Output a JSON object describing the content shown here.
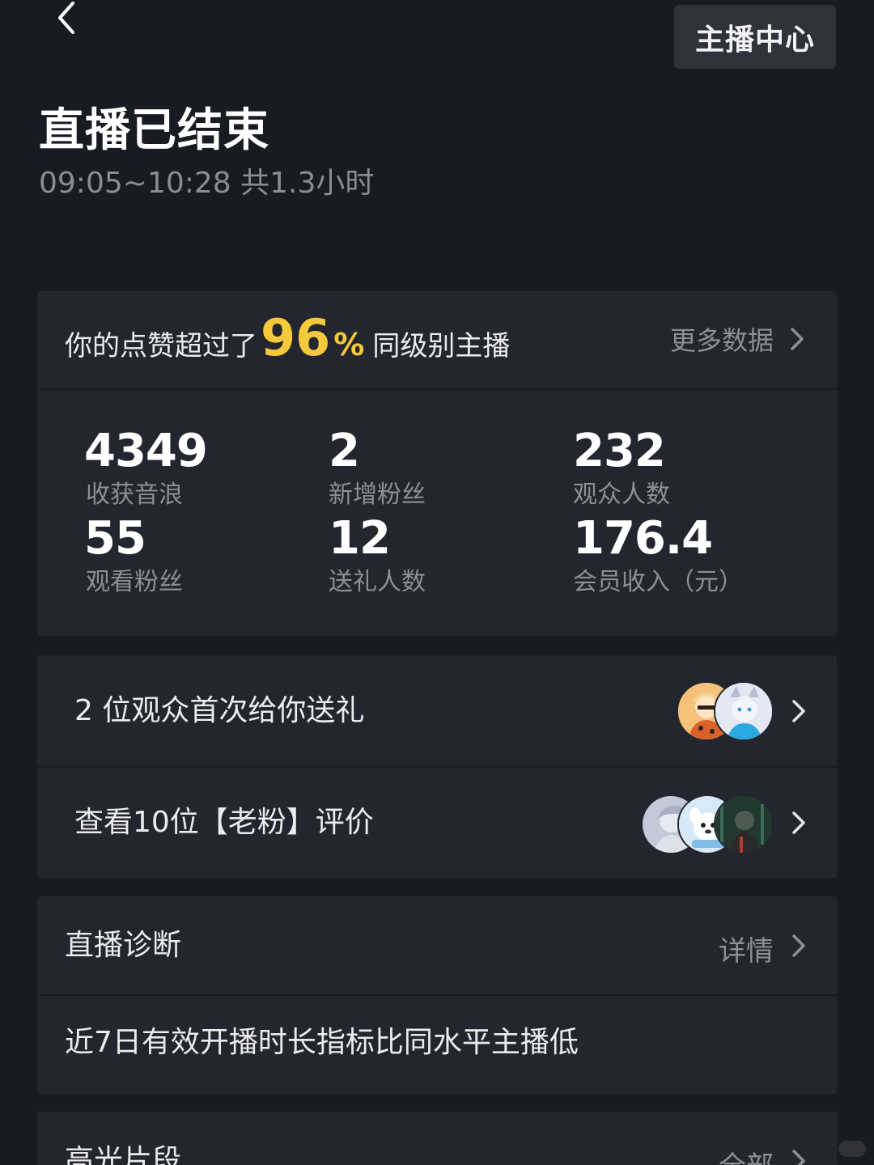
{
  "header": {
    "back_icon": "chevron-left-icon",
    "anchor_center_label": "主播中心"
  },
  "live": {
    "title": "直播已结束",
    "time_range": "09:05~10:28 共1.3小时"
  },
  "likes": {
    "prefix": "你的点赞超过了",
    "percent": "96",
    "percent_sign": "%",
    "suffix": "同级别主播",
    "more_label": "更多数据"
  },
  "stats": [
    {
      "value": "4349",
      "label": "收获音浪"
    },
    {
      "value": "2",
      "label": "新增粉丝"
    },
    {
      "value": "232",
      "label": "观众人数"
    },
    {
      "value": "55",
      "label": "观看粉丝"
    },
    {
      "value": "12",
      "label": "送礼人数"
    },
    {
      "value": "176.4",
      "label": "会员收入（元）"
    }
  ],
  "gift_row": {
    "label": "2 位观众首次给你送礼",
    "avatars": [
      "avatar-orange",
      "avatar-cat"
    ]
  },
  "review_row": {
    "label": "查看10位【老粉】评价",
    "avatars": [
      "avatar-pale",
      "avatar-dog",
      "avatar-dark"
    ]
  },
  "diagnosis": {
    "title": "直播诊断",
    "detail_label": "详情",
    "message": "近7日有效开播时长指标比同水平主播低"
  },
  "highlights": {
    "title": "高光片段",
    "all_label": "全部"
  },
  "colors": {
    "background": "#181b22",
    "card": "#23262e",
    "accent": "#f6c93a",
    "muted_text": "#8d9097"
  }
}
